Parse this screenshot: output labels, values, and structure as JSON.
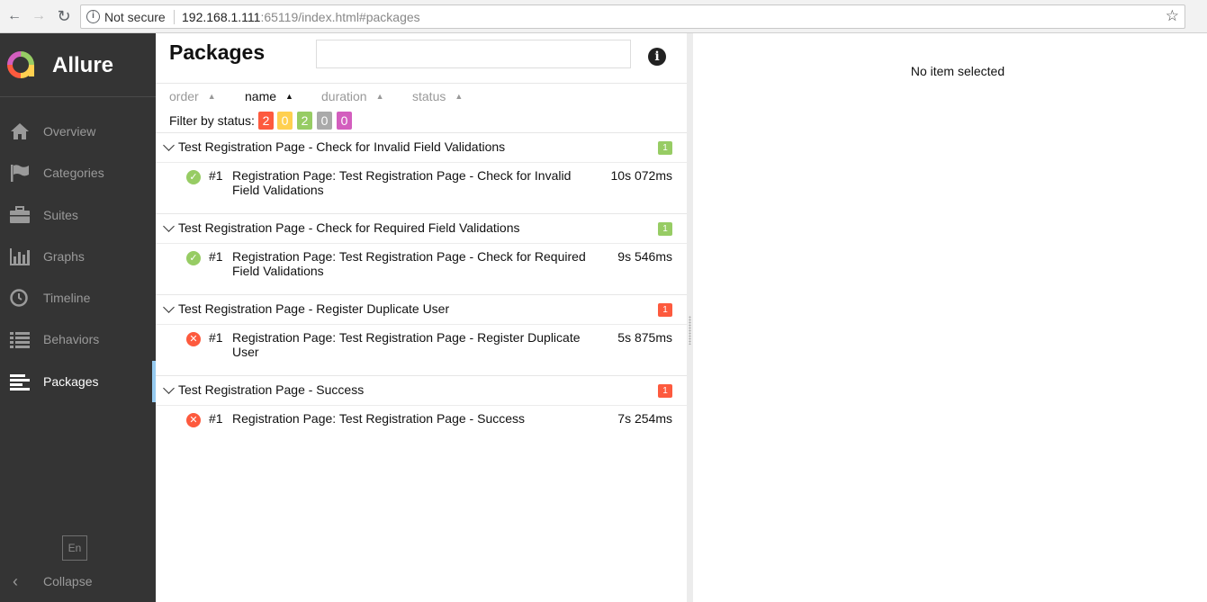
{
  "browser": {
    "security_label": "Not secure",
    "url_host": "192.168.1.111",
    "url_rest": ":65119/index.html#packages"
  },
  "sidebar": {
    "brand": "Allure",
    "items": [
      {
        "label": "Overview",
        "icon": "home-icon"
      },
      {
        "label": "Categories",
        "icon": "flag-icon"
      },
      {
        "label": "Suites",
        "icon": "briefcase-icon"
      },
      {
        "label": "Graphs",
        "icon": "bar-chart-icon"
      },
      {
        "label": "Timeline",
        "icon": "clock-icon"
      },
      {
        "label": "Behaviors",
        "icon": "list-icon"
      },
      {
        "label": "Packages",
        "icon": "align-left-icon",
        "active": true
      }
    ],
    "language": "En",
    "collapse_label": "Collapse"
  },
  "packages": {
    "title": "Packages",
    "search_value": "",
    "sorters": [
      {
        "label": "order"
      },
      {
        "label": "name",
        "active": true
      },
      {
        "label": "duration"
      },
      {
        "label": "status"
      }
    ],
    "filter_label": "Filter by status:",
    "filter_counts": [
      {
        "value": "2",
        "color": "#fd5a3e"
      },
      {
        "value": "0",
        "color": "#ffd050"
      },
      {
        "value": "2",
        "color": "#97cc64"
      },
      {
        "value": "0",
        "color": "#aaaaaa"
      },
      {
        "value": "0",
        "color": "#d35ebe"
      }
    ],
    "groups": [
      {
        "title": "Test Registration Page - Check for Invalid Field Validations",
        "count": "1",
        "count_color": "#97cc64",
        "items": [
          {
            "num": "#1",
            "name": "Registration Page: Test Registration Page - Check for Invalid Field Validations",
            "duration": "10s 072ms",
            "status": "passed"
          }
        ]
      },
      {
        "title": "Test Registration Page - Check for Required Field Validations",
        "count": "1",
        "count_color": "#97cc64",
        "items": [
          {
            "num": "#1",
            "name": "Registration Page: Test Registration Page - Check for Required Field Validations",
            "duration": "9s 546ms",
            "status": "passed"
          }
        ]
      },
      {
        "title": "Test Registration Page - Register Duplicate User",
        "count": "1",
        "count_color": "#fd5a3e",
        "items": [
          {
            "num": "#1",
            "name": "Registration Page: Test Registration Page - Register Duplicate User",
            "duration": "5s 875ms",
            "status": "failed"
          }
        ]
      },
      {
        "title": "Test Registration Page - Success",
        "count": "1",
        "count_color": "#fd5a3e",
        "items": [
          {
            "num": "#1",
            "name": "Registration Page: Test Registration Page - Success",
            "duration": "7s 254ms",
            "status": "failed"
          }
        ]
      }
    ]
  },
  "detail": {
    "empty_message": "No item selected"
  },
  "colors": {
    "passed": "#97cc64",
    "failed": "#fd5a3e",
    "sidebar_bg": "#343434",
    "accent": "#97cbf0"
  }
}
